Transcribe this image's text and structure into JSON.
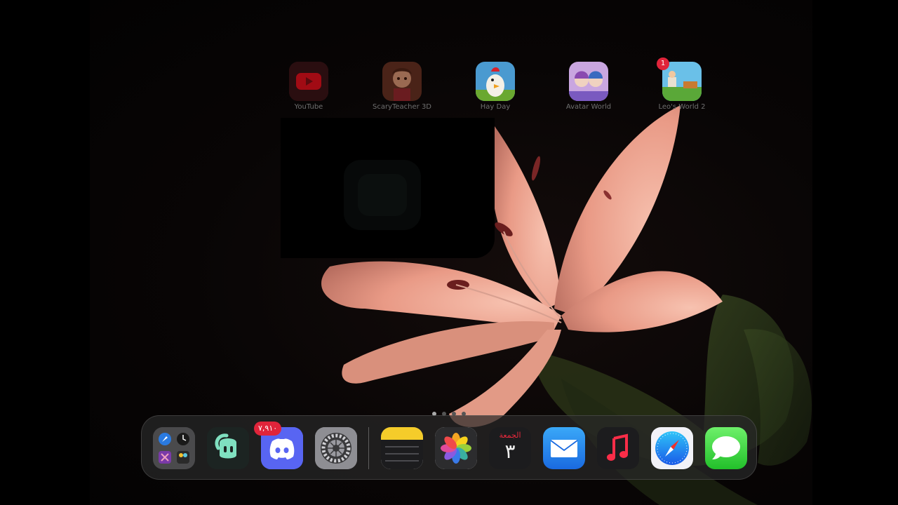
{
  "colors": {
    "accent_red": "#e0243a",
    "petal": "#eda08c",
    "dock_bg": "#282828"
  },
  "home_apps": [
    {
      "label": "YouTube",
      "icon": "youtube-icon"
    },
    {
      "label": "ScaryTeacher 3D",
      "icon": "scary-teacher-icon"
    },
    {
      "label": "Hay Day",
      "icon": "hay-day-icon"
    },
    {
      "label": "Avatar World",
      "icon": "avatar-world-icon"
    },
    {
      "label": "Leo's World 2",
      "icon": "leos-world-icon",
      "badge": "1"
    }
  ],
  "page_indicator": {
    "pages": 4,
    "current": 1
  },
  "dock": {
    "discord_badge": "٧,٩١٠",
    "calendar": {
      "day": "الجمعة",
      "date": "٣"
    },
    "items": [
      {
        "name": "app-library-folder",
        "icon": "folder-grid-icon"
      },
      {
        "name": "chat-app",
        "icon": "chat-bot-icon"
      },
      {
        "name": "discord",
        "icon": "discord-icon"
      },
      {
        "name": "settings",
        "icon": "gear-icon"
      },
      {
        "name": "notes",
        "icon": "notes-icon"
      },
      {
        "name": "photos",
        "icon": "photos-icon"
      },
      {
        "name": "calendar",
        "icon": "calendar-icon"
      },
      {
        "name": "mail",
        "icon": "mail-icon"
      },
      {
        "name": "music",
        "icon": "music-icon"
      },
      {
        "name": "safari",
        "icon": "safari-icon"
      },
      {
        "name": "messages",
        "icon": "messages-icon"
      }
    ]
  }
}
